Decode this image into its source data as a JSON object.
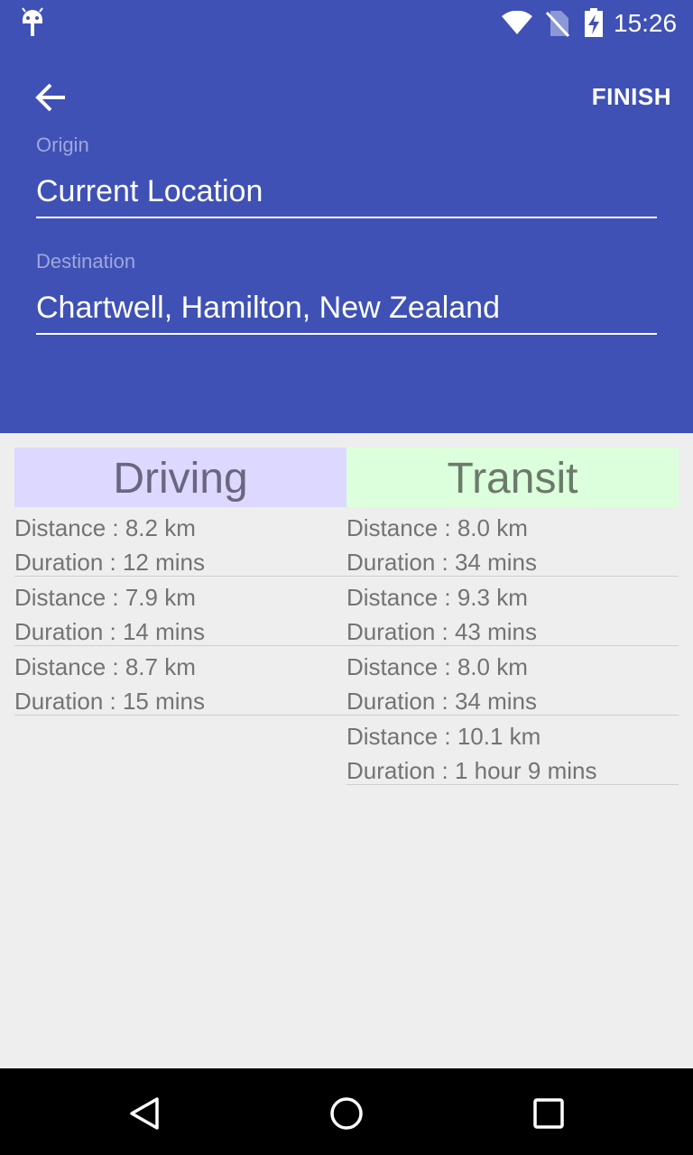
{
  "status_bar": {
    "time": "15:26",
    "icons": [
      "android-icon",
      "wifi-icon",
      "no-sim-icon",
      "battery-charging-icon"
    ]
  },
  "toolbar": {
    "back_icon": "arrow-back-icon",
    "finish_label": "FINISH"
  },
  "form": {
    "origin_label": "Origin",
    "origin_value": "Current Location",
    "destination_label": "Destination",
    "destination_value": "Chartwell, Hamilton, New Zealand"
  },
  "driving": {
    "title": "Driving",
    "routes": [
      {
        "distance": "Distance : 8.2 km",
        "duration": "Duration : 12 mins"
      },
      {
        "distance": "Distance : 7.9 km",
        "duration": "Duration : 14 mins"
      },
      {
        "distance": "Distance : 8.7 km",
        "duration": "Duration : 15 mins"
      }
    ]
  },
  "transit": {
    "title": "Transit",
    "routes": [
      {
        "distance": "Distance : 8.0 km",
        "duration": "Duration : 34 mins"
      },
      {
        "distance": "Distance : 9.3 km",
        "duration": "Duration : 43 mins"
      },
      {
        "distance": "Distance : 8.0 km",
        "duration": "Duration : 34 mins"
      },
      {
        "distance": "Distance : 10.1 km",
        "duration": "Duration : 1 hour 9 mins"
      }
    ]
  },
  "nav_bar": {
    "icons": [
      "back-triangle-icon",
      "home-circle-icon",
      "recents-square-icon"
    ]
  },
  "colors": {
    "primary": "#3f51b5",
    "driving_header_bg": "#ddd8ff",
    "transit_header_bg": "#dcffdc",
    "background": "#eeeeee"
  }
}
